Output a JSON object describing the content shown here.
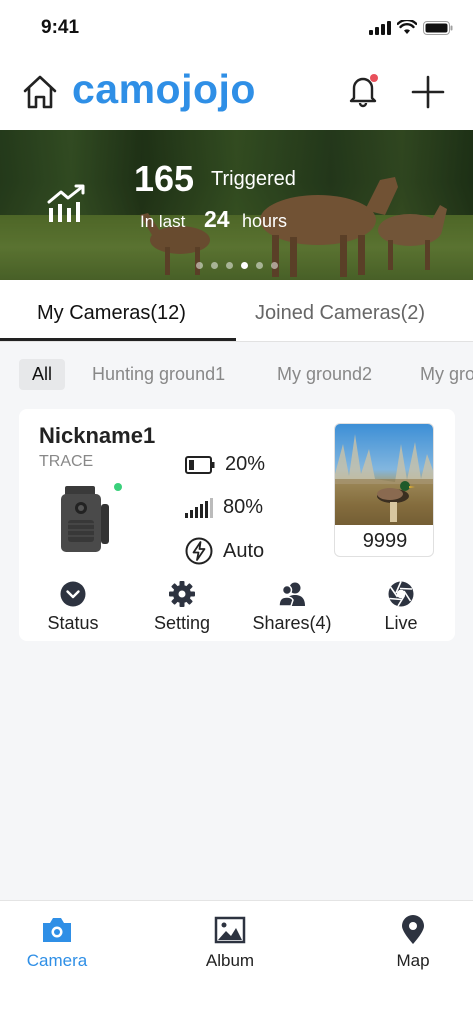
{
  "status_bar": {
    "time": "9:41"
  },
  "header": {
    "logo": "camojojo"
  },
  "banner": {
    "triggered_count": "165",
    "triggered_label": "Triggered",
    "in_last": "In last",
    "hours_value": "24",
    "hours_label": "hours",
    "slide_count": 6,
    "active_slide": 4
  },
  "tabs": [
    {
      "label": "My Cameras(12)",
      "active": true
    },
    {
      "label": "Joined Cameras(2)",
      "active": false
    }
  ],
  "filters": [
    {
      "label": "All",
      "active": true
    },
    {
      "label": "Hunting ground1",
      "active": false
    },
    {
      "label": "My ground2",
      "active": false
    },
    {
      "label": "My gro",
      "active": false
    }
  ],
  "camera_card": {
    "nickname": "Nickname1",
    "model": "TRACE",
    "battery": "20%",
    "signal": "80%",
    "power_mode": "Auto",
    "photo_count": "9999",
    "actions": [
      {
        "label": "Status",
        "icon": "chevron-down-circle-icon"
      },
      {
        "label": "Setting",
        "icon": "gear-icon"
      },
      {
        "label": "Shares(4)",
        "icon": "users-icon"
      },
      {
        "label": "Live",
        "icon": "aperture-icon"
      }
    ]
  },
  "bottom_nav": [
    {
      "label": "Camera",
      "icon": "camera-icon",
      "active": true
    },
    {
      "label": "Album",
      "icon": "image-icon",
      "active": false
    },
    {
      "label": "Map",
      "icon": "map-pin-icon",
      "active": false
    }
  ],
  "colors": {
    "accent": "#2f8fe6",
    "online": "#3ad07b",
    "notification": "#e8505b"
  }
}
